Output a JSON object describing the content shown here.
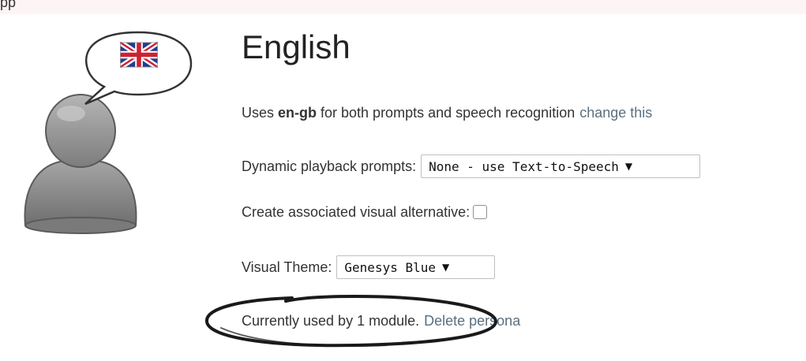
{
  "top_strip": {
    "glyph": "pp"
  },
  "persona": {
    "title": "English",
    "language_prefix": "Uses",
    "language_code": "en-gb",
    "language_suffix": "for both prompts and speech recognition",
    "change_link": "change this",
    "playback_label": "Dynamic playback prompts:",
    "playback_selected": "None - use Text-to-Speech",
    "visual_alt_label": "Create associated visual alternative:",
    "visual_alt_checked": false,
    "theme_label": "Visual Theme:",
    "theme_selected": "Genesys Blue",
    "usage_text": "Currently used by 1 module.",
    "delete_link": "Delete persona"
  },
  "icons": {
    "avatar": "person-icon",
    "speech_bubble": "speech-bubble-icon",
    "flag": "uk-flag-icon",
    "dropdown": "dropdown-caret-icon"
  },
  "colors": {
    "link": "#5a6f80",
    "avatar_gray": "#8c8c8c",
    "annotation_ink": "#1a1a1a"
  }
}
